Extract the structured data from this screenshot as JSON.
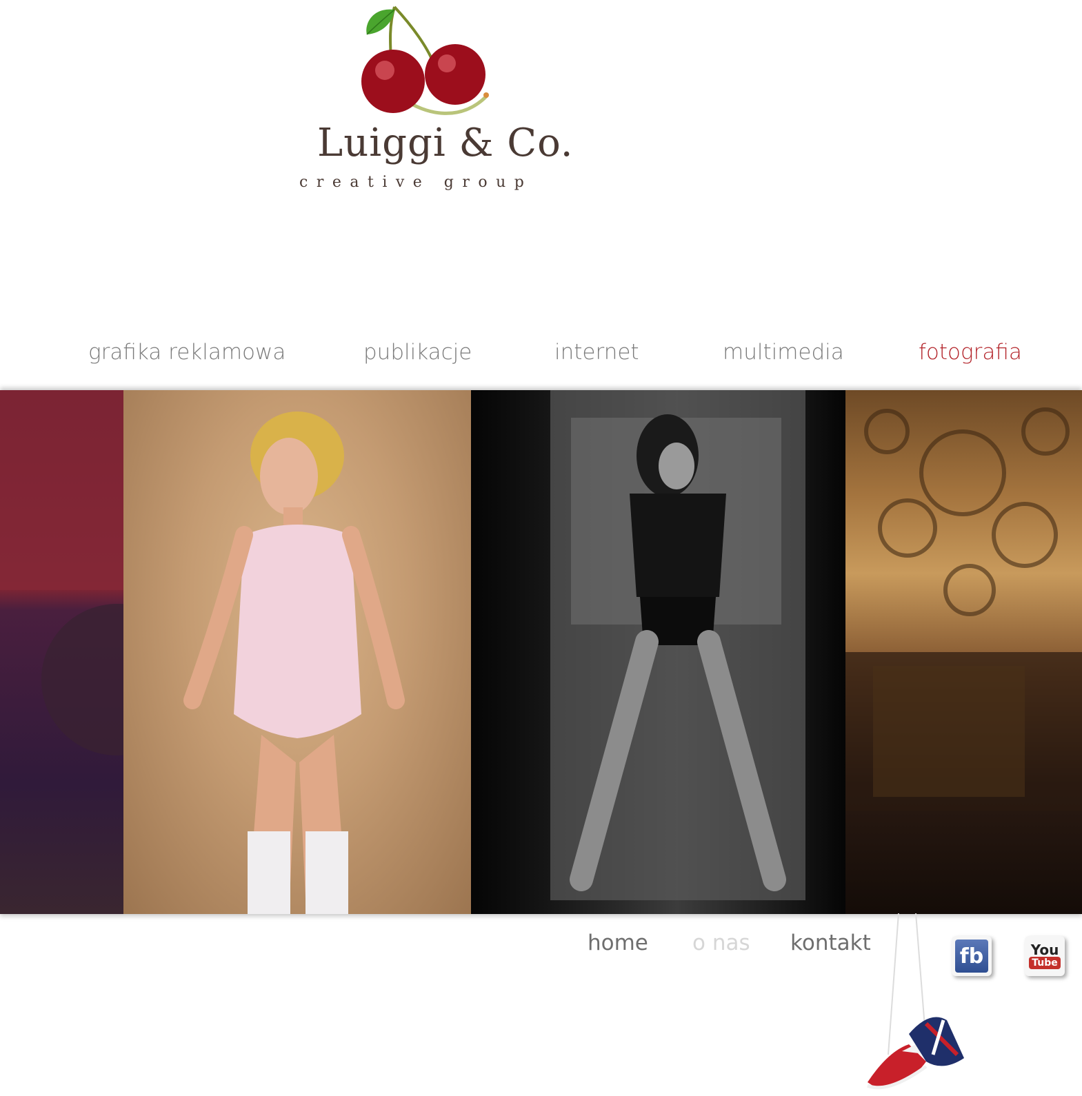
{
  "brand": {
    "name": "Luiggi & Co.",
    "tagline": "creative group"
  },
  "nav_top": {
    "items": [
      {
        "label": "grafika reklamowa",
        "active": false
      },
      {
        "label": "publikacje",
        "active": false
      },
      {
        "label": "internet",
        "active": false
      },
      {
        "label": "multimedia",
        "active": false
      },
      {
        "label": "fotografia",
        "active": true
      }
    ],
    "active_color": "#b3242a"
  },
  "nav_bottom": {
    "items": [
      {
        "label": "home",
        "active": true
      },
      {
        "label": "o nas",
        "active": false
      },
      {
        "label": "kontakt",
        "active": true
      }
    ]
  },
  "social": {
    "facebook": {
      "label": "fb",
      "icon": "facebook-icon"
    },
    "youtube": {
      "label_top": "You",
      "label_bottom": "Tube",
      "icon": "youtube-icon"
    }
  },
  "gallery": {
    "photos": [
      {
        "name": "photo-red-interior"
      },
      {
        "name": "photo-pink-lingerie"
      },
      {
        "name": "photo-bw-door"
      },
      {
        "name": "photo-ornamental-interior"
      }
    ]
  }
}
